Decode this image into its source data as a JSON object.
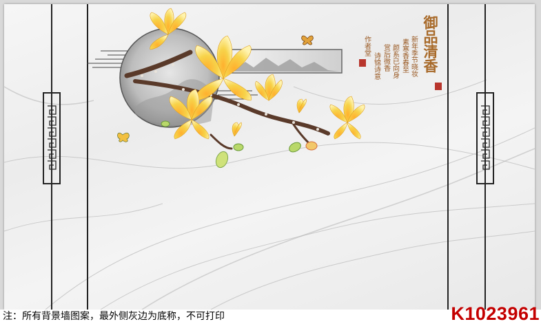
{
  "title": "御品清香",
  "poem_columns": [
    "新年季节晓妆",
    "素寒香春至",
    "颜系已向身",
    "赏后微香",
    "诗锦诗意",
    "作者堂"
  ],
  "footer": {
    "note": "注：所有背景墙图案，最外侧灰边为底称，不可打印",
    "code": "K1023961"
  },
  "colors": {
    "outer_border": "#d9d9d9",
    "marble": "#f2f2f2",
    "line": "#222222",
    "flower": "#f7d34a",
    "title": "#a86a2a",
    "code": "#c40000"
  }
}
